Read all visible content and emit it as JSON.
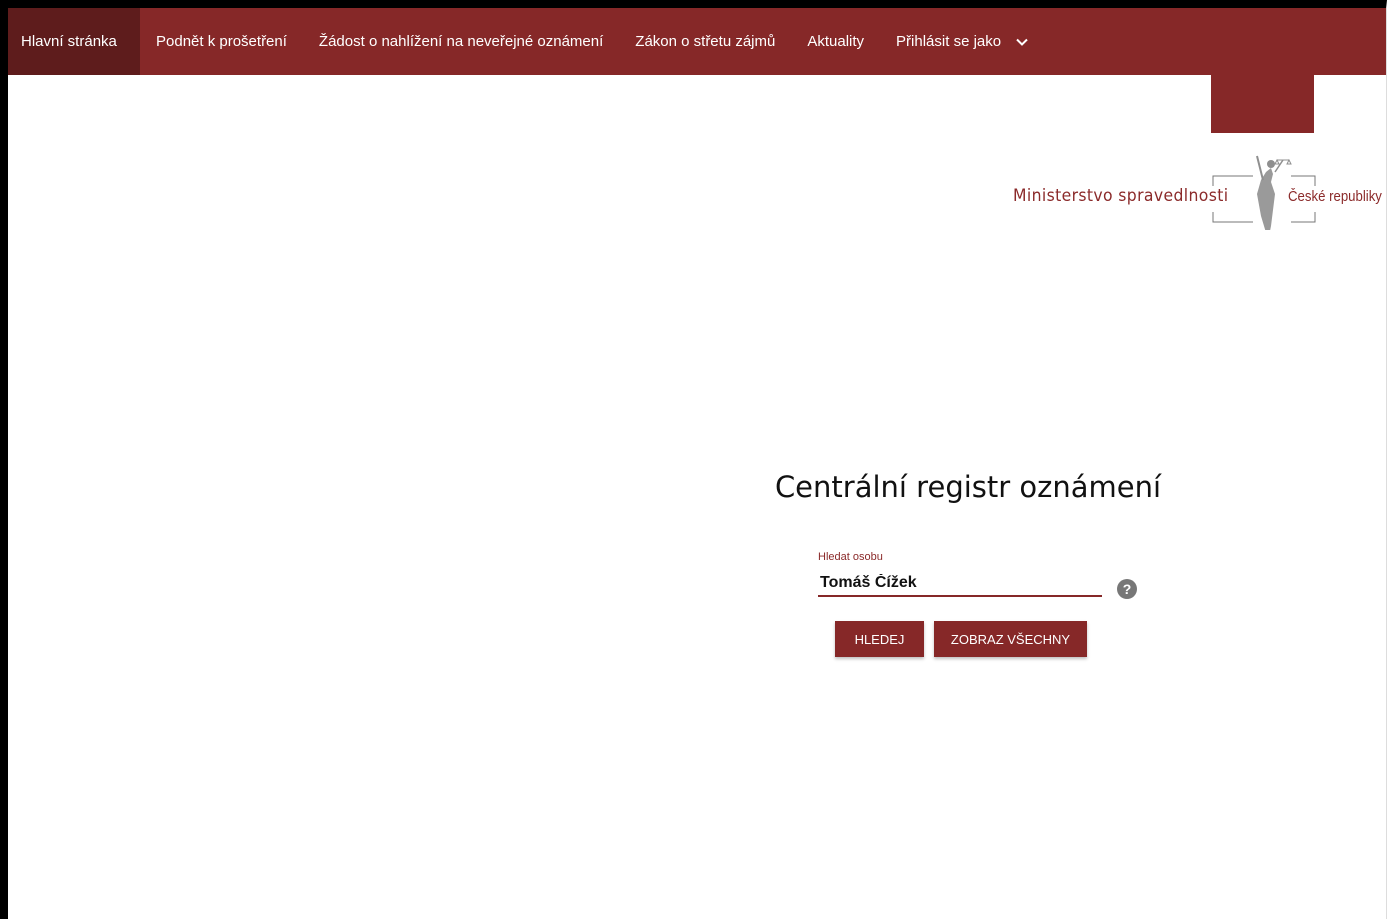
{
  "nav": {
    "items": [
      {
        "label": "Hlavní stránka",
        "active": true
      },
      {
        "label": "Podnět k prošetření",
        "active": false
      },
      {
        "label": "Žádost o nahlížení na neveřejné oznámení",
        "active": false
      },
      {
        "label": "Zákon o střetu zájmů",
        "active": false
      },
      {
        "label": "Aktuality",
        "active": false
      },
      {
        "label": "Přihlásit se jako",
        "active": false,
        "icon": "chevron-down-icon"
      }
    ]
  },
  "logo": {
    "left_text": "Ministerstvo spravedlnosti",
    "right_text": "České republiky",
    "icon": "justice-statue-emblem"
  },
  "main": {
    "title": "Centrální registr oznámení",
    "search": {
      "label": "Hledat osobu",
      "value": "Tomáš Čížek"
    },
    "help_icon_label": "?",
    "buttons": {
      "search_label": "Hledej",
      "show_all_label": "Zobraz všechny"
    }
  },
  "colors": {
    "brand": "#862828",
    "nav_active": "#5e1c1c",
    "text": "#111111"
  }
}
